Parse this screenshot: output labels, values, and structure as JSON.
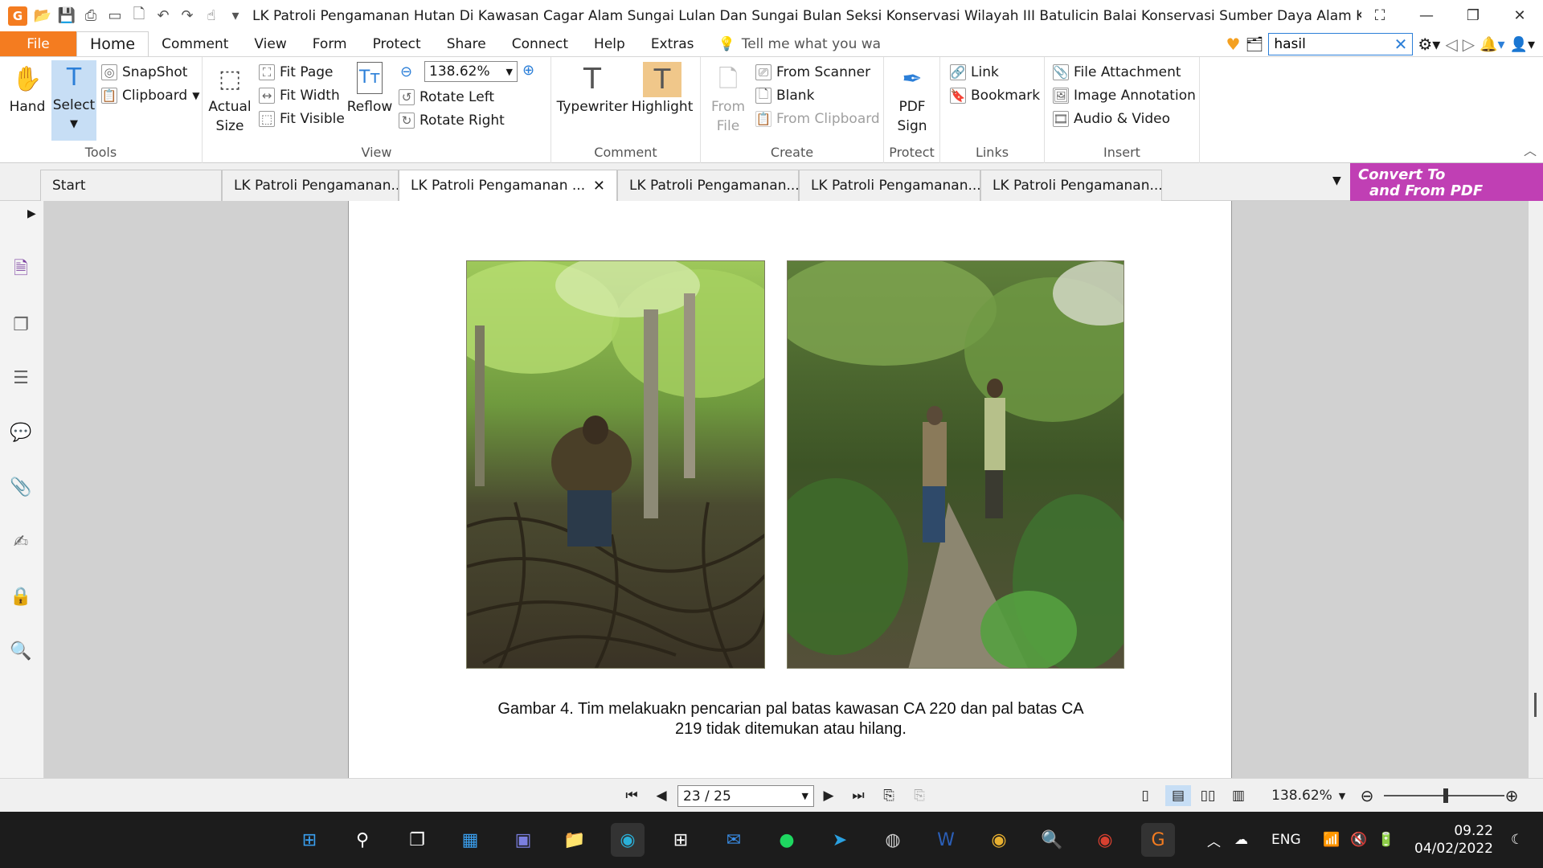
{
  "window": {
    "title": "LK Patroli Pengamanan Hutan Di Kawasan Cagar Alam Sungai Lulan Dan Sungai Bulan Seksi Konservasi Wilayah III Batulicin Balai Konservasi Sumber Daya Alam Kalimanta..."
  },
  "menu": {
    "file": "File",
    "items": [
      "Home",
      "Comment",
      "View",
      "Form",
      "Protect",
      "Share",
      "Connect",
      "Help",
      "Extras"
    ],
    "tell_me": "Tell me what you wa",
    "search_value": "hasil"
  },
  "ribbon": {
    "tools": {
      "label": "Tools",
      "hand": "Hand",
      "select": "Select",
      "snapshot": "SnapShot",
      "clipboard": "Clipboard"
    },
    "view": {
      "label": "View",
      "actual_size_1": "Actual",
      "actual_size_2": "Size",
      "fit_page": "Fit Page",
      "fit_width": "Fit Width",
      "fit_visible": "Fit Visible",
      "reflow": "Reflow",
      "zoom": "138.62%",
      "rotate_left": "Rotate Left",
      "rotate_right": "Rotate Right"
    },
    "comment": {
      "label": "Comment",
      "typewriter": "Typewriter",
      "highlight": "Highlight"
    },
    "create": {
      "label": "Create",
      "from_file_1": "From",
      "from_file_2": "File",
      "from_scanner": "From Scanner",
      "blank": "Blank",
      "from_clipboard": "From Clipboard"
    },
    "protect": {
      "label": "Protect",
      "pdf_sign_1": "PDF",
      "pdf_sign_2": "Sign"
    },
    "links": {
      "label": "Links",
      "link": "Link",
      "bookmark": "Bookmark"
    },
    "insert": {
      "label": "Insert",
      "file_attachment": "File Attachment",
      "image_annotation": "Image Annotation",
      "audio_video": "Audio & Video"
    }
  },
  "tabs": [
    {
      "label": "Start"
    },
    {
      "label": "LK Patroli Pengamanan..."
    },
    {
      "label": "LK Patroli Pengamanan ..."
    },
    {
      "label": "LK Patroli Pengamanan..."
    },
    {
      "label": "LK Patroli Pengamanan..."
    },
    {
      "label": "LK Patroli Pengamanan..."
    }
  ],
  "convert_banner": {
    "line1": "Convert To",
    "line2": "and From PDF"
  },
  "document": {
    "caption_line1": "Gambar 4. Tim melakuakn pencarian pal batas kawasan CA 220 dan pal batas CA",
    "caption_line2": "219  tidak ditemukan atau hilang."
  },
  "statusbar": {
    "page": "23 / 25",
    "zoom": "138.62%"
  },
  "taskbar": {
    "language": "ENG",
    "time": "09.22",
    "date": "04/02/2022"
  },
  "colors": {
    "accent": "#f47c20",
    "select_bg": "#c7def5",
    "convert_bg": "#c03fb4",
    "doc_bg": "#d1d1d1"
  }
}
